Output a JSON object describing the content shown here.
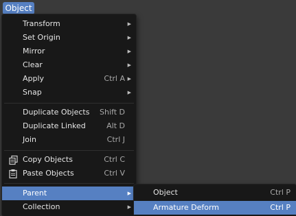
{
  "header": {
    "menu_label": "Object"
  },
  "menu": {
    "items": [
      {
        "label": "Transform",
        "shortcut": "",
        "submenu": true
      },
      {
        "label": "Set Origin",
        "shortcut": "",
        "submenu": true
      },
      {
        "label": "Mirror",
        "shortcut": "",
        "submenu": true
      },
      {
        "label": "Clear",
        "shortcut": "",
        "submenu": true
      },
      {
        "label": "Apply",
        "shortcut": "Ctrl A",
        "submenu": true
      },
      {
        "label": "Snap",
        "shortcut": "",
        "submenu": true
      },
      {
        "label": "Duplicate Objects",
        "shortcut": "Shift D",
        "submenu": false
      },
      {
        "label": "Duplicate Linked",
        "shortcut": "Alt D",
        "submenu": false
      },
      {
        "label": "Join",
        "shortcut": "Ctrl J",
        "submenu": false
      },
      {
        "label": "Copy Objects",
        "shortcut": "Ctrl C",
        "submenu": false,
        "icon": "copy-icon"
      },
      {
        "label": "Paste Objects",
        "shortcut": "Ctrl V",
        "submenu": false,
        "icon": "paste-icon"
      },
      {
        "label": "Parent",
        "shortcut": "",
        "submenu": true,
        "highlighted": true
      },
      {
        "label": "Collection",
        "shortcut": "",
        "submenu": true
      }
    ]
  },
  "submenu": {
    "items": [
      {
        "label": "Object",
        "shortcut": "Ctrl P"
      },
      {
        "label": "Armature Deform",
        "shortcut": "Ctrl P",
        "highlighted": true
      }
    ]
  },
  "colors": {
    "highlight": "#5680c2",
    "menu_bg": "#181818",
    "background": "#3a3a3a"
  },
  "icons": {
    "submenu_arrow": "▶"
  }
}
